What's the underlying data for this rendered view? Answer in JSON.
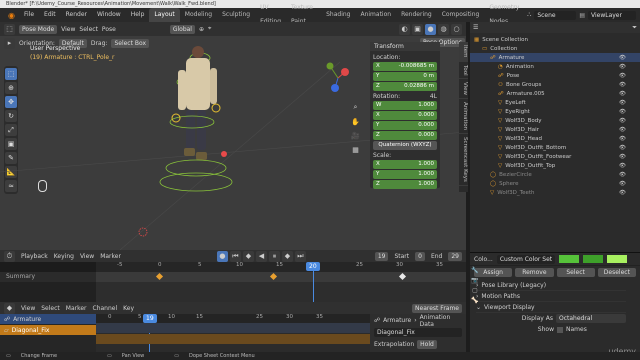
{
  "title_bar": "Blender* [F:\\Udemy_Course_Resources\\Animation\\Movement\\Walk\\Walk_Fwd.blend]",
  "menu": [
    "File",
    "Edit",
    "Render",
    "Window",
    "Help"
  ],
  "workspaces": [
    "Layout",
    "Modeling",
    "Sculpting",
    "UV Editing",
    "Texture Paint",
    "Shading",
    "Animation",
    "Rendering",
    "Compositing",
    "Geometry Nodes"
  ],
  "scene": "Scene",
  "view_layer": "ViewLayer",
  "viewport": {
    "mode": "Pose Mode",
    "view": "View",
    "select": "Select",
    "pose": "Pose",
    "orientation_label": "Orientation:",
    "orientation": "Default",
    "drag_label": "Drag:",
    "drag": "Select Box",
    "transform_orient": "Global",
    "pose_options": "Pose Options",
    "info_line1": "User Perspective",
    "info_line2": "(19) Armature : CTRL_Pole_r"
  },
  "npanel": {
    "header": "Transform",
    "location_label": "Location:",
    "location": [
      [
        "X",
        "-0.008685 m"
      ],
      [
        "Y",
        "0 m"
      ],
      [
        "Z",
        "0.02886 m"
      ]
    ],
    "rotation_label": "Rotation:",
    "rotation_mode": "4L",
    "rotation": [
      [
        "W",
        "1.000"
      ],
      [
        "X",
        "0.000"
      ],
      [
        "Y",
        "0.000"
      ],
      [
        "Z",
        "0.000"
      ]
    ],
    "quat_mode": "Quaternion (WXYZ)",
    "scale_label": "Scale:",
    "scale": [
      [
        "X",
        "1.000"
      ],
      [
        "Y",
        "1.000"
      ],
      [
        "Z",
        "1.000"
      ]
    ],
    "tabs": [
      "Item",
      "Tool",
      "View",
      "Animation",
      "Screencast Keys"
    ]
  },
  "outliner": {
    "items": [
      {
        "label": "Scene Collection",
        "indent": 0
      },
      {
        "label": "Collection",
        "indent": 1
      },
      {
        "label": "Armature",
        "indent": 2
      },
      {
        "label": "Animation",
        "indent": 3
      },
      {
        "label": "Pose",
        "indent": 3
      },
      {
        "label": "Bone Groups",
        "indent": 3
      },
      {
        "label": "Armature.005",
        "indent": 3
      },
      {
        "label": "EyeLeft",
        "indent": 3
      },
      {
        "label": "EyeRight",
        "indent": 3
      },
      {
        "label": "Wolf3D_Body",
        "indent": 3
      },
      {
        "label": "Wolf3D_Hair",
        "indent": 3
      },
      {
        "label": "Wolf3D_Head",
        "indent": 3
      },
      {
        "label": "Wolf3D_Outfit_Bottom",
        "indent": 3
      },
      {
        "label": "Wolf3D_Outfit_Footwear",
        "indent": 3
      },
      {
        "label": "Wolf3D_Outfit_Top",
        "indent": 3
      },
      {
        "label": "BezierCircle",
        "indent": 2
      },
      {
        "label": "Sphere",
        "indent": 2
      },
      {
        "label": "Wolf3D_Teeth",
        "indent": 2
      }
    ]
  },
  "properties": {
    "color_label": "Colo...",
    "color_set": "Custom Color Set",
    "buttons": [
      "Assign",
      "Remove",
      "Select",
      "Deselect"
    ],
    "sections": [
      "Pose Library (Legacy)",
      "Motion Paths",
      "Viewport Display"
    ],
    "display_as_label": "Display As",
    "display_as": "Octahedral",
    "show_label": "Show",
    "names": "Names",
    "accent": "#56c23a"
  },
  "timeline": {
    "playback": "Playback",
    "keying": "Keying",
    "view": "View",
    "marker": "Marker",
    "current": "19",
    "start_label": "Start",
    "start": "0",
    "end_label": "End",
    "end": "29",
    "ticks": [
      "-5",
      "0",
      "5",
      "10",
      "15",
      "20",
      "25",
      "30",
      "35"
    ],
    "summary": "Summary"
  },
  "dopesheet": {
    "menu": [
      "View",
      "Select",
      "Marker",
      "Channel",
      "Key"
    ],
    "snap": "Nearest Frame",
    "armature": "Armature",
    "action": "Diagonal_Fix",
    "channels": [
      "Armature",
      "Diagonal_Fix"
    ],
    "current": "19",
    "ticks": [
      "0",
      "5",
      "10",
      "15",
      "20",
      "25",
      "30",
      "35"
    ],
    "breadcrumb": [
      "Armature",
      "Animation Data"
    ],
    "action_field": "Diagonal_Fix",
    "extrap_label": "Extrapolation",
    "extrap": "Hold"
  },
  "status": [
    "Change Frame",
    "Pan View",
    "Dope Sheet Context Menu"
  ],
  "watermark": "udemy"
}
